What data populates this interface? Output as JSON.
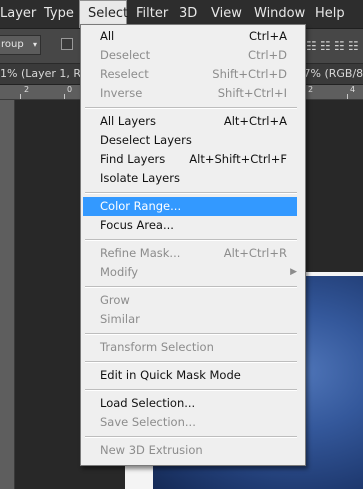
{
  "menubar": {
    "items": [
      "Layer",
      "Type",
      "Select",
      "Filter",
      "3D",
      "View",
      "Window",
      "Help"
    ],
    "active": "Select"
  },
  "options": {
    "dropdown_value": "roup",
    "align_icons": [
      "align-top-icon",
      "align-vcenter-icon",
      "align-bottom-icon",
      "align-left-icon"
    ]
  },
  "tabs": {
    "left_text": "1% (Layer 1, RG",
    "right_text": ".7% (RGB/8)"
  },
  "ruler": {
    "labels": [
      "2",
      "0",
      "2",
      "4"
    ]
  },
  "select_menu": {
    "groups": [
      [
        {
          "label": "All",
          "shortcut": "Ctrl+A",
          "enabled": true
        },
        {
          "label": "Deselect",
          "shortcut": "Ctrl+D",
          "enabled": false
        },
        {
          "label": "Reselect",
          "shortcut": "Shift+Ctrl+D",
          "enabled": false
        },
        {
          "label": "Inverse",
          "shortcut": "Shift+Ctrl+I",
          "enabled": false
        }
      ],
      [
        {
          "label": "All Layers",
          "shortcut": "Alt+Ctrl+A",
          "enabled": true
        },
        {
          "label": "Deselect Layers",
          "shortcut": "",
          "enabled": true
        },
        {
          "label": "Find Layers",
          "shortcut": "Alt+Shift+Ctrl+F",
          "enabled": true
        },
        {
          "label": "Isolate Layers",
          "shortcut": "",
          "enabled": true
        }
      ],
      [
        {
          "label": "Color Range...",
          "shortcut": "",
          "enabled": true,
          "highlighted": true
        },
        {
          "label": "Focus Area...",
          "shortcut": "",
          "enabled": true
        }
      ],
      [
        {
          "label": "Refine Mask...",
          "shortcut": "Alt+Ctrl+R",
          "enabled": false
        },
        {
          "label": "Modify",
          "shortcut": "",
          "enabled": false,
          "submenu": true
        }
      ],
      [
        {
          "label": "Grow",
          "shortcut": "",
          "enabled": false
        },
        {
          "label": "Similar",
          "shortcut": "",
          "enabled": false
        }
      ],
      [
        {
          "label": "Transform Selection",
          "shortcut": "",
          "enabled": false
        }
      ],
      [
        {
          "label": "Edit in Quick Mask Mode",
          "shortcut": "",
          "enabled": true
        }
      ],
      [
        {
          "label": "Load Selection...",
          "shortcut": "",
          "enabled": true
        },
        {
          "label": "Save Selection...",
          "shortcut": "",
          "enabled": false
        }
      ],
      [
        {
          "label": "New 3D Extrusion",
          "shortcut": "",
          "enabled": false
        }
      ]
    ]
  },
  "colors": {
    "highlight": "#3399ff",
    "menu_bg": "#efefef",
    "app_bg": "#282828"
  }
}
